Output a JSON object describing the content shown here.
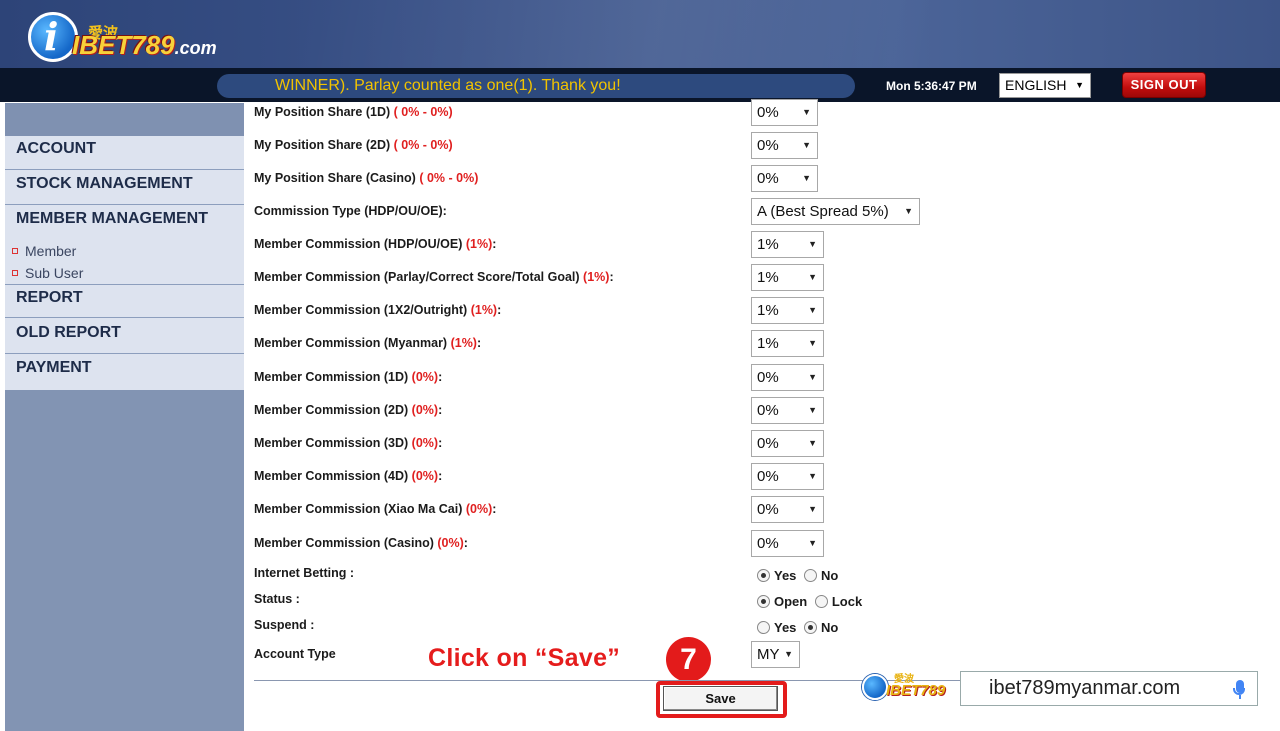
{
  "header": {
    "logo_cn": "愛波",
    "logo_brand": "IBET789",
    "logo_sub": ".com"
  },
  "topbar": {
    "marquee": "WINNER). Parlay counted as one(1). Thank you!",
    "clock": "Mon 5:36:47 PM",
    "language": "ENGLISH",
    "sign_out": "SIGN OUT"
  },
  "sidebar": {
    "items": [
      {
        "label": "ACCOUNT"
      },
      {
        "label": "STOCK MANAGEMENT"
      },
      {
        "label": "MEMBER MANAGEMENT"
      },
      {
        "label": "REPORT"
      },
      {
        "label": "OLD REPORT"
      },
      {
        "label": "PAYMENT"
      }
    ],
    "subitems": [
      {
        "label": "Member"
      },
      {
        "label": "Sub User"
      }
    ]
  },
  "form": {
    "rows": [
      {
        "label": "My Position Share (1D)",
        "range": " ( 0% - 0%)",
        "suffix": "",
        "value": "0%"
      },
      {
        "label": "My Position Share (2D)",
        "range": " ( 0% - 0%)",
        "suffix": "",
        "value": "0%"
      },
      {
        "label": "My Position Share (Casino)",
        "range": " ( 0% - 0%)",
        "suffix": "",
        "value": "0%"
      },
      {
        "label": "Commission Type (HDP/OU/OE):",
        "range": "",
        "suffix": "",
        "value": "A (Best Spread 5%)"
      },
      {
        "label": "Member Commission (HDP/OU/OE)",
        "range": " (1%)",
        "suffix": ":",
        "value": "1%"
      },
      {
        "label": "Member Commission (Parlay/Correct Score/Total Goal)",
        "range": " (1%)",
        "suffix": ":",
        "value": "1%"
      },
      {
        "label": "Member Commission (1X2/Outright)",
        "range": " (1%)",
        "suffix": ":",
        "value": "1%"
      },
      {
        "label": "Member Commission (Myanmar)",
        "range": " (1%)",
        "suffix": ":",
        "value": "1%"
      },
      {
        "label": "Member Commission (1D)",
        "range": " (0%)",
        "suffix": ":",
        "value": "0%"
      },
      {
        "label": "Member Commission (2D)",
        "range": " (0%)",
        "suffix": ":",
        "value": "0%"
      },
      {
        "label": "Member Commission (3D)",
        "range": " (0%)",
        "suffix": ":",
        "value": "0%"
      },
      {
        "label": "Member Commission (4D)",
        "range": " (0%)",
        "suffix": ":",
        "value": "0%"
      },
      {
        "label": "Member Commission (Xiao Ma Cai)",
        "range": " (0%)",
        "suffix": ":",
        "value": "0%"
      },
      {
        "label": "Member Commission (Casino)",
        "range": " (0%)",
        "suffix": ":",
        "value": "0%"
      }
    ],
    "internet_betting": {
      "label": "Internet Betting :",
      "opt1": "Yes",
      "opt2": "No"
    },
    "status": {
      "label": "Status :",
      "opt1": "Open",
      "opt2": "Lock"
    },
    "suspend": {
      "label": "Suspend :",
      "opt1": "Yes",
      "opt2": "No"
    },
    "account_type": {
      "label": "Account Type",
      "value": "MY"
    },
    "save_label": "Save"
  },
  "annotation": {
    "callout": "Click on “Save”",
    "step": "7"
  },
  "footer": {
    "mini_logo_brand": "IBET789",
    "mini_logo_cn": "愛波",
    "search_text": "ibet789myanmar.com"
  }
}
